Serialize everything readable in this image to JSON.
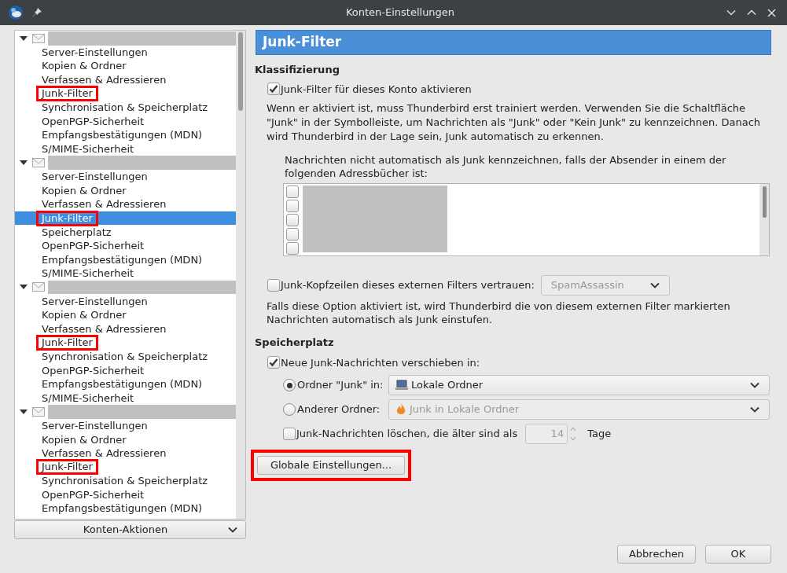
{
  "window": {
    "title": "Konten-Einstellungen"
  },
  "sidebar": {
    "accounts": [
      {
        "expanded": true,
        "items": [
          {
            "label": "Server-Einstellungen",
            "selected": false,
            "highlighted": false
          },
          {
            "label": "Kopien & Ordner",
            "selected": false,
            "highlighted": false
          },
          {
            "label": "Verfassen & Adressieren",
            "selected": false,
            "highlighted": false
          },
          {
            "label": "Junk-Filter",
            "selected": false,
            "highlighted": true
          },
          {
            "label": "Synchronisation & Speicherplatz",
            "selected": false,
            "highlighted": false
          },
          {
            "label": "OpenPGP-Sicherheit",
            "selected": false,
            "highlighted": false
          },
          {
            "label": "Empfangsbestätigungen (MDN)",
            "selected": false,
            "highlighted": false
          },
          {
            "label": "S/MIME-Sicherheit",
            "selected": false,
            "highlighted": false
          }
        ]
      },
      {
        "expanded": true,
        "items": [
          {
            "label": "Server-Einstellungen",
            "selected": false,
            "highlighted": false
          },
          {
            "label": "Kopien & Ordner",
            "selected": false,
            "highlighted": false
          },
          {
            "label": "Verfassen & Adressieren",
            "selected": false,
            "highlighted": false
          },
          {
            "label": "Junk-Filter",
            "selected": true,
            "highlighted": true
          },
          {
            "label": "Speicherplatz",
            "selected": false,
            "highlighted": false
          },
          {
            "label": "OpenPGP-Sicherheit",
            "selected": false,
            "highlighted": false
          },
          {
            "label": "Empfangsbestätigungen (MDN)",
            "selected": false,
            "highlighted": false
          },
          {
            "label": "S/MIME-Sicherheit",
            "selected": false,
            "highlighted": false
          }
        ]
      },
      {
        "expanded": true,
        "items": [
          {
            "label": "Server-Einstellungen",
            "selected": false,
            "highlighted": false
          },
          {
            "label": "Kopien & Ordner",
            "selected": false,
            "highlighted": false
          },
          {
            "label": "Verfassen & Adressieren",
            "selected": false,
            "highlighted": false
          },
          {
            "label": "Junk-Filter",
            "selected": false,
            "highlighted": true
          },
          {
            "label": "Synchronisation & Speicherplatz",
            "selected": false,
            "highlighted": false
          },
          {
            "label": "OpenPGP-Sicherheit",
            "selected": false,
            "highlighted": false
          },
          {
            "label": "Empfangsbestätigungen (MDN)",
            "selected": false,
            "highlighted": false
          },
          {
            "label": "S/MIME-Sicherheit",
            "selected": false,
            "highlighted": false
          }
        ]
      },
      {
        "expanded": true,
        "items": [
          {
            "label": "Server-Einstellungen",
            "selected": false,
            "highlighted": false
          },
          {
            "label": "Kopien & Ordner",
            "selected": false,
            "highlighted": false
          },
          {
            "label": "Verfassen & Adressieren",
            "selected": false,
            "highlighted": false
          },
          {
            "label": "Junk-Filter",
            "selected": false,
            "highlighted": true
          },
          {
            "label": "Synchronisation & Speicherplatz",
            "selected": false,
            "highlighted": false
          },
          {
            "label": "OpenPGP-Sicherheit",
            "selected": false,
            "highlighted": false
          },
          {
            "label": "Empfangsbestätigungen (MDN)",
            "selected": false,
            "highlighted": false
          }
        ]
      }
    ],
    "actions_button": "Konten-Aktionen"
  },
  "panel": {
    "title": "Junk-Filter",
    "classification": {
      "heading": "Klassifizierung",
      "enable": {
        "label": "Junk-Filter für dieses Konto aktivieren",
        "checked": true
      },
      "description": "Wenn er aktiviert ist, muss Thunderbird erst trainiert werden. Verwenden Sie die Schaltfläche \"Junk\" in der Symbolleiste, um Nachrichten als \"Junk\" oder \"Kein Junk\" zu kennzeichnen. Danach wird Thunderbird in der Lage sein, Junk automatisch zu erkennen.",
      "whitelist_label": "Nachrichten nicht automatisch als Junk kennzeichnen, falls der Absender in einem der folgenden Adressbücher ist:",
      "address_books": [
        {
          "checked": false
        },
        {
          "checked": false
        },
        {
          "checked": false
        },
        {
          "checked": false
        },
        {
          "checked": false
        }
      ],
      "trust_headers": {
        "label": "Junk-Kopfzeilen dieses externen Filters vertrauen:",
        "checked": false
      },
      "filter_select": {
        "value": "SpamAssassin",
        "disabled": true
      },
      "trust_description": "Falls diese Option aktiviert ist, wird Thunderbird die von diesem externen Filter markierten Nachrichten automatisch als Junk einstufen."
    },
    "storage": {
      "heading": "Speicherplatz",
      "move": {
        "label": "Neue Junk-Nachrichten verschieben in:",
        "checked": true
      },
      "options": [
        {
          "label": "Ordner \"Junk\" in:",
          "selected": true,
          "select": {
            "value": "Lokale Ordner",
            "disabled": false
          }
        },
        {
          "label": "Anderer Ordner:",
          "selected": false,
          "select": {
            "value": "Junk in Lokale Ordner",
            "disabled": true
          }
        }
      ],
      "delete": {
        "label": "Junk-Nachrichten löschen, die älter sind als",
        "checked": false,
        "value": "14",
        "unit": "Tage"
      }
    },
    "global_button": {
      "label": "Globale Einstellungen...",
      "highlighted": true
    }
  },
  "buttons": [
    "Abbrechen",
    "OK"
  ]
}
